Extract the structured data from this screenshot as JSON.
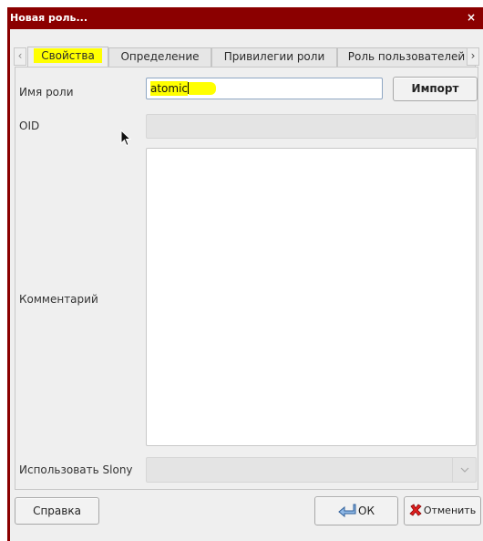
{
  "window": {
    "title": "Новая роль...",
    "close_glyph": "×"
  },
  "tabs": [
    {
      "label": "Свойства",
      "active": true
    },
    {
      "label": "Определение",
      "active": false
    },
    {
      "label": "Привилегии роли",
      "active": false
    },
    {
      "label": "Роль пользователей",
      "active": false
    }
  ],
  "tab_scroll": {
    "left": "‹",
    "right": "›"
  },
  "form": {
    "role_name": {
      "label": "Имя роли",
      "value": "atomic"
    },
    "import_button": "Импорт",
    "oid": {
      "label": "OID",
      "value": ""
    },
    "comment": {
      "label": "Комментарий",
      "value": ""
    },
    "slony": {
      "label": "Использовать Slony",
      "value": ""
    }
  },
  "footer": {
    "help_button": "Справка",
    "ok_button": "ОК",
    "cancel_button": "Отменить"
  },
  "colors": {
    "titlebar": "#8b0000",
    "highlight": "#ffff00",
    "dialog_bg": "#efefef"
  },
  "icons": {
    "close": "close-icon",
    "ok": "ok-arrow-icon",
    "cancel": "cancel-x-icon",
    "dropdown": "chevron-down-icon",
    "cursor": "mouse-pointer-icon"
  }
}
